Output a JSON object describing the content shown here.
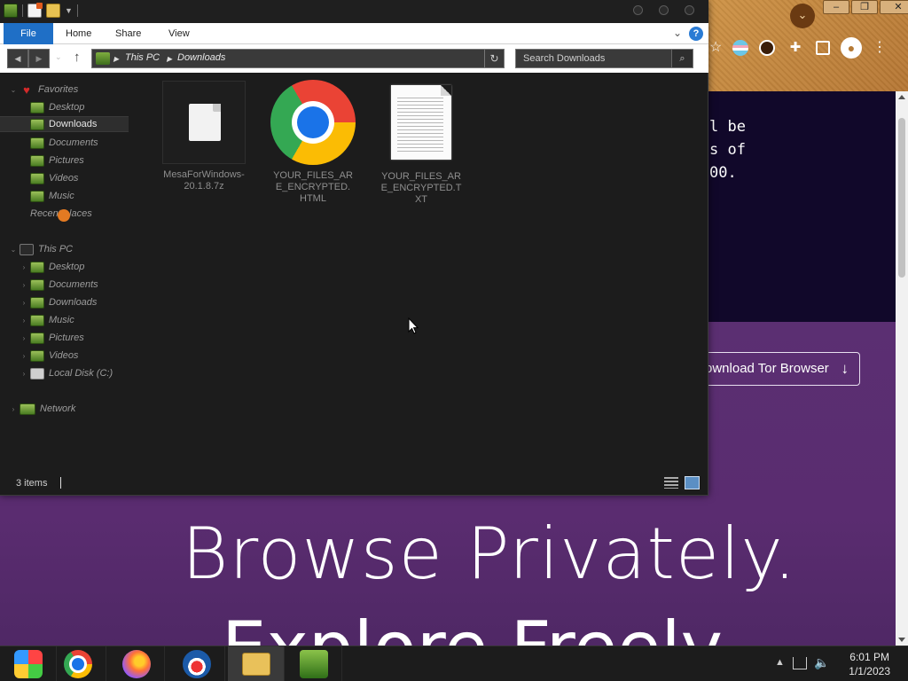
{
  "background_browser": {
    "code_lines": [
      "l be",
      "s of",
      "00."
    ],
    "download_button": "ownload Tor Browser",
    "hero_line1": "Browse Privately.",
    "hero_line2": "Explore Freely."
  },
  "explorer": {
    "ribbon": {
      "file": "File",
      "home": "Home",
      "share": "Share",
      "view": "View"
    },
    "address": {
      "root": "This PC",
      "current": "Downloads"
    },
    "search": {
      "placeholder": "Search Downloads"
    },
    "nav": {
      "favorites": "Favorites",
      "fav_items": [
        "Desktop",
        "Downloads",
        "Documents",
        "Pictures",
        "Videos",
        "Music",
        "Recent places"
      ],
      "this_pc": "This PC",
      "pc_items": [
        "Desktop",
        "Documents",
        "Downloads",
        "Music",
        "Pictures",
        "Videos",
        "Local Disk (C:)"
      ],
      "network": "Network",
      "selected": "Downloads"
    },
    "files": [
      {
        "name": "MesaForWindows-20.1.8.7z",
        "icon": "archive-file-icon"
      },
      {
        "name": "YOUR_FILES_ARE_ENCRYPTED.HTML",
        "icon": "chrome-html-file-icon"
      },
      {
        "name": "YOUR_FILES_ARE_ENCRYPTED.TXT",
        "icon": "text-file-icon"
      }
    ],
    "status": {
      "item_count": "3 items"
    }
  },
  "taskbar": {
    "apps": [
      "start-button",
      "chrome",
      "firefox",
      "obama-logo-app",
      "file-explorer",
      "network-app"
    ],
    "clock_time": "6:01 PM",
    "clock_date": "1/1/2023"
  }
}
